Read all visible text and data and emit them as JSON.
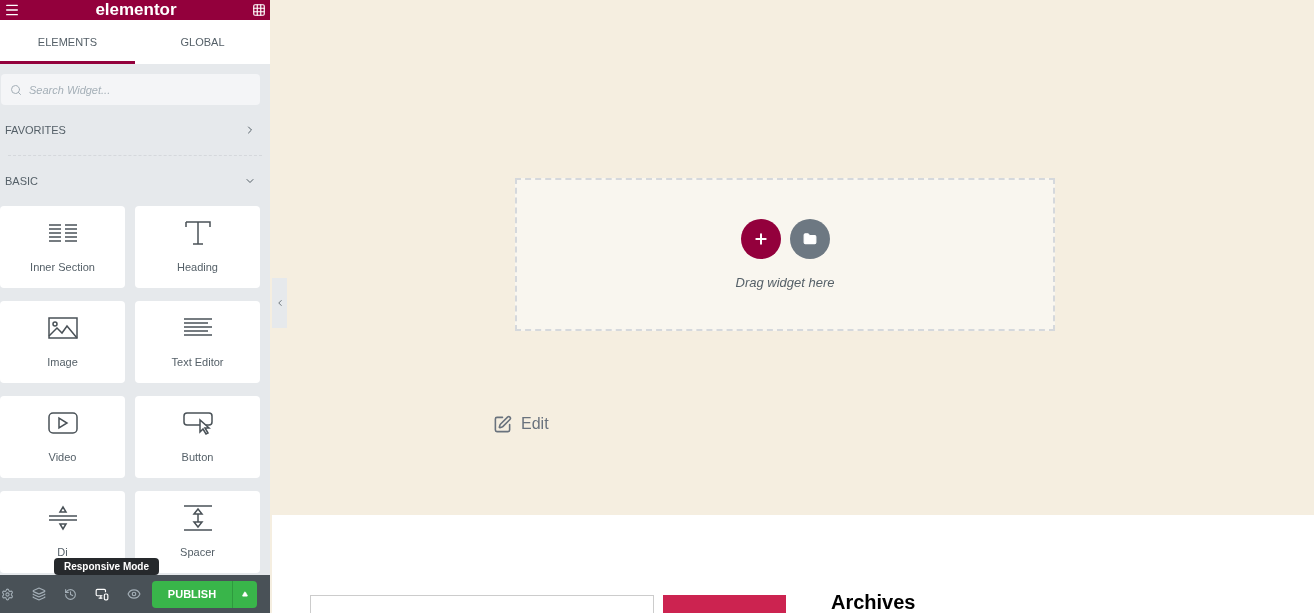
{
  "header": {
    "logo": "elementor"
  },
  "tabs": [
    {
      "label": "ELEMENTS",
      "selected": true
    },
    {
      "label": "GLOBAL",
      "selected": false
    }
  ],
  "search": {
    "placeholder": "Search Widget..."
  },
  "categories": [
    {
      "label": "FAVORITES",
      "expanded": false
    },
    {
      "label": "BASIC",
      "expanded": true
    }
  ],
  "widgets": [
    {
      "label": "Inner Section",
      "kind": "columns"
    },
    {
      "label": "Heading",
      "kind": "heading"
    },
    {
      "label": "Image",
      "kind": "image"
    },
    {
      "label": "Text Editor",
      "kind": "text"
    },
    {
      "label": "Video",
      "kind": "video"
    },
    {
      "label": "Button",
      "kind": "button"
    },
    {
      "label": "Di",
      "kind": "divider"
    },
    {
      "label": "Spacer",
      "kind": "spacer"
    }
  ],
  "tooltip": "Responsive Mode",
  "footer": {
    "publish": "PUBLISH"
  },
  "canvas": {
    "drop_hint": "Drag widget here",
    "edit": "Edit",
    "heading": "Archives"
  }
}
